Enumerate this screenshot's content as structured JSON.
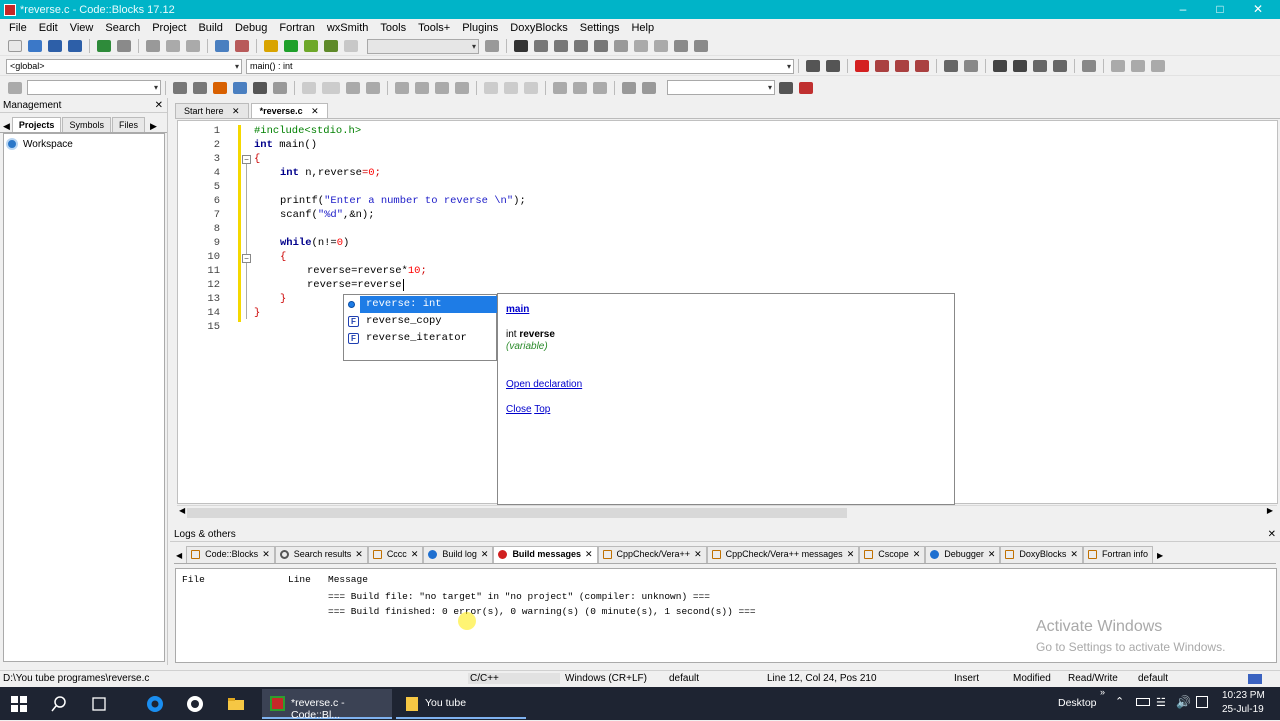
{
  "window": {
    "title": "*reverse.c - Code::Blocks 17.12"
  },
  "menu": [
    "File",
    "Edit",
    "View",
    "Search",
    "Project",
    "Build",
    "Debug",
    "Fortran",
    "wxSmith",
    "Tools",
    "Tools+",
    "Plugins",
    "DoxyBlocks",
    "Settings",
    "Help"
  ],
  "scope": {
    "global": "<global>",
    "function": "main() : int"
  },
  "management": {
    "title": "Management",
    "tabs": [
      "Projects",
      "Symbols",
      "Files"
    ],
    "workspace": "Workspace"
  },
  "editor_tabs": [
    "Start here",
    "*reverse.c"
  ],
  "code": {
    "line_numbers": [
      "1",
      "2",
      "3",
      "4",
      "5",
      "6",
      "7",
      "8",
      "9",
      "10",
      "11",
      "12",
      "13",
      "14",
      "15"
    ]
  },
  "autocomplete": {
    "items": [
      "reverse: int",
      "reverse_copy",
      "reverse_iterator"
    ]
  },
  "doc_popup": {
    "name": "main",
    "type": "int",
    "symbol": "reverse",
    "kind": "(variable)",
    "open_declaration": "Open declaration",
    "close": "Close",
    "top": "Top"
  },
  "logs": {
    "title": "Logs & others",
    "tabs": [
      "Code::Blocks",
      "Search results",
      "Cccc",
      "Build log",
      "Build messages",
      "CppCheck/Vera++",
      "CppCheck/Vera++ messages",
      "Cscope",
      "Debugger",
      "DoxyBlocks",
      "Fortran info"
    ],
    "columns": [
      "File",
      "Line",
      "Message"
    ],
    "messages": [
      "=== Build file: \"no target\" in \"no project\" (compiler: unknown) ===",
      "=== Build finished: 0 error(s), 0 warning(s) (0 minute(s), 1 second(s)) ==="
    ]
  },
  "watermark": {
    "line1": "Activate Windows",
    "line2": "Go to Settings to activate Windows."
  },
  "status": {
    "path": "D:\\You tube programes\\reverse.c",
    "lang": "C/C++",
    "eol": "Windows (CR+LF)",
    "encoding": "default",
    "position": "Line 12, Col 24, Pos 210",
    "mode": "Insert",
    "modified": "Modified",
    "access": "Read/Write",
    "profile": "default"
  },
  "taskbar": {
    "task1": "*reverse.c - Code::Bl...",
    "task2": "You tube",
    "desktop": "Desktop",
    "time": "10:23 PM",
    "date": "25-Jul-19"
  }
}
